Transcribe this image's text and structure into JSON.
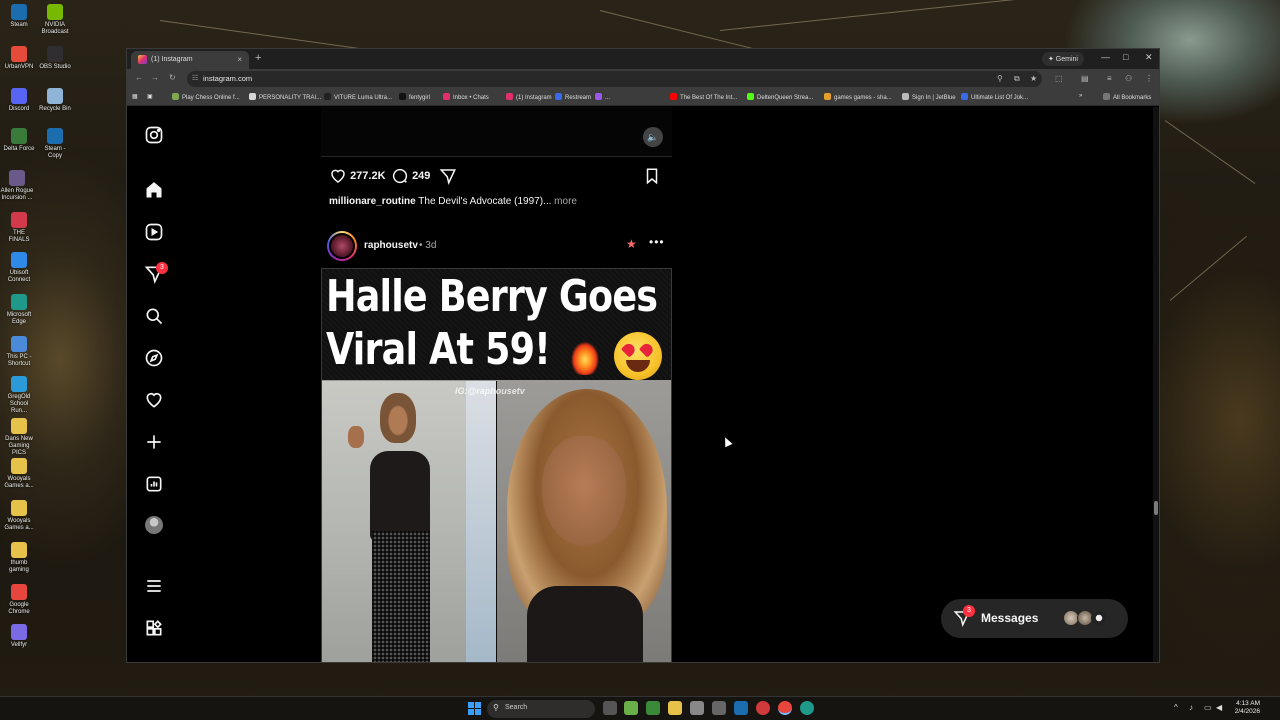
{
  "desktop": {
    "icons": [
      {
        "label": "Steam",
        "color": "#1b6db0"
      },
      {
        "label": "NVIDIA Broadcast",
        "color": "#76b900"
      },
      {
        "label": "UrbanVPN",
        "color": "#e64a3b"
      },
      {
        "label": "OBS Studio",
        "color": "#302e31"
      },
      {
        "label": "Discord",
        "color": "#5865f2"
      },
      {
        "label": "Recycle Bin",
        "color": "#8fb4d8"
      },
      {
        "label": "Delta Force",
        "color": "#3a7a3a"
      },
      {
        "label": "Steam - Copy",
        "color": "#1b6db0"
      },
      {
        "label": "Allen Rogue Incursion ...",
        "color": "#6a5a8a"
      },
      {
        "label": "THE FINALS",
        "color": "#d03a4a"
      },
      {
        "label": "Ubisoft Connect",
        "color": "#2e8ae6"
      },
      {
        "label": "Microsoft Edge",
        "color": "#1f9a8a"
      },
      {
        "label": "This PC - Shortcut",
        "color": "#4a8ad8"
      },
      {
        "label": "GregOld School Run...",
        "color": "#2a9ad8"
      },
      {
        "label": "Dans New Gaming PICS",
        "color": "#e6c24a"
      },
      {
        "label": "Wooyals Games a...",
        "color": "#e6c24a"
      },
      {
        "label": "Wooyals Games a...",
        "color": "#e6c24a"
      },
      {
        "label": "thumb gaming",
        "color": "#e6c24a"
      },
      {
        "label": "Google Chrome",
        "color": "#e8453c"
      },
      {
        "label": "Vellfyr",
        "color": "#7a6ae6"
      }
    ]
  },
  "browser": {
    "tab_title": "(1) Instagram",
    "tab_close": "×",
    "new_tab": "+",
    "gemini_label": "✦ Gemini",
    "url": "instagram.com",
    "bookmarks": [
      {
        "label": "Play Chess Online f...",
        "color": "#7fa650"
      },
      {
        "label": "PERSONALITY TRAI...",
        "color": "#d8d8d8"
      },
      {
        "label": "VITURE Luma Ultra...",
        "color": "#222222"
      },
      {
        "label": "fentygirl",
        "color": "#111111"
      },
      {
        "label": "Inbox • Chats",
        "color": "#e1306c"
      },
      {
        "label": "(1) Instagram",
        "color": "#e1306c"
      },
      {
        "label": "Restream",
        "color": "#3a6ae6"
      },
      {
        "label": "...",
        "color": "#9a5ae6"
      },
      {
        "label": "The Best Of The Int...",
        "color": "#ff0000"
      },
      {
        "label": "DeltenQueen Strea...",
        "color": "#53fc18"
      },
      {
        "label": "games games - sha...",
        "color": "#e6a02a"
      },
      {
        "label": "Sign In | JetBlue",
        "color": "#bbbbbb"
      },
      {
        "label": "Ultimate List Of Jok...",
        "color": "#3a6ae6"
      }
    ],
    "all_bookmarks": "All Bookmarks"
  },
  "instagram": {
    "prev_post": {
      "likes": "277.2K",
      "comments": "249",
      "caption_user": "millionare_routine",
      "caption_text": "The Devil's Advocate (1997)...",
      "more": "more"
    },
    "post": {
      "username": "raphousetv",
      "separator": "•",
      "time": "3d",
      "headline_line1": "Halle Berry Goes",
      "headline_line2": "Viral At 59!",
      "watermark": "IG:@raphousetv"
    },
    "notifications_badge": "3",
    "messages": {
      "label": "Messages",
      "badge": "3"
    }
  },
  "taskbar": {
    "search_placeholder": "Search",
    "time": "4:13 AM",
    "date": "2/4/2026"
  }
}
